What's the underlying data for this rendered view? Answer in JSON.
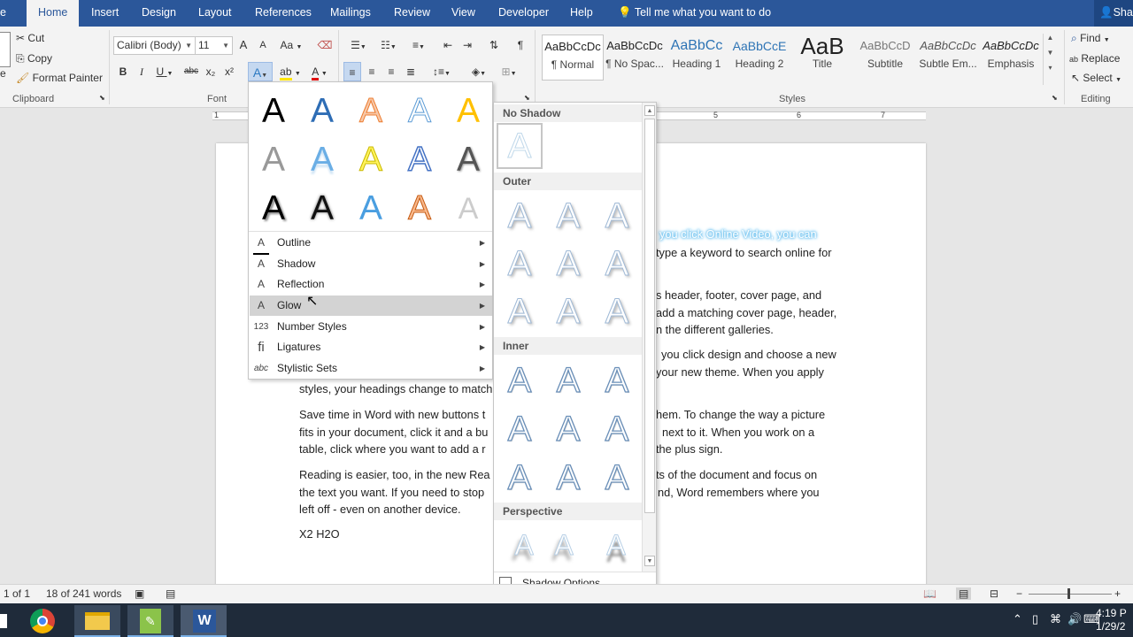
{
  "tabs": [
    {
      "label": "e",
      "active": false
    },
    {
      "label": "Home",
      "active": true
    },
    {
      "label": "Insert",
      "active": false
    },
    {
      "label": "Design",
      "active": false
    },
    {
      "label": "Layout",
      "active": false
    },
    {
      "label": "References",
      "active": false
    },
    {
      "label": "Mailings",
      "active": false
    },
    {
      "label": "Review",
      "active": false
    },
    {
      "label": "View",
      "active": false
    },
    {
      "label": "Developer",
      "active": false
    },
    {
      "label": "Help",
      "active": false
    }
  ],
  "tell_me": "Tell me what you want to do",
  "user_share": "Sha",
  "clipboard": {
    "cut": "Cut",
    "copy": "Copy",
    "format_painter": "Format Painter",
    "label": "Clipboard"
  },
  "font": {
    "name": "Calibri (Body)",
    "size": "11",
    "label": "Font",
    "bold": "B",
    "italic": "I",
    "underline": "U",
    "strike": "abc",
    "subscript": "x₂",
    "superscript": "x²",
    "grow": "A",
    "shrink": "A",
    "case": "Aa"
  },
  "styles": {
    "label": "Styles",
    "items": [
      {
        "preview": "AaBbCcDc",
        "name": "¶ Normal",
        "selected": true
      },
      {
        "preview": "AaBbCcDc",
        "name": "¶ No Spac...",
        "selected": false
      },
      {
        "preview": "AaBbCc",
        "name": "Heading 1",
        "selected": false
      },
      {
        "preview": "AaBbCcE",
        "name": "Heading 2",
        "selected": false
      },
      {
        "preview": "AaB",
        "name": "Title",
        "selected": false
      },
      {
        "preview": "AaBbCcD",
        "name": "Subtitle",
        "selected": false
      },
      {
        "preview": "AaBbCcDc",
        "name": "Subtle Em...",
        "selected": false
      },
      {
        "preview": "AaBbCcDc",
        "name": "Emphasis",
        "selected": false
      }
    ]
  },
  "editing": {
    "find": "Find",
    "replace": "Replace",
    "select": "Select",
    "label": "Editing"
  },
  "ruler_marks": [
    "1",
    "5",
    "6",
    "7"
  ],
  "document": {
    "glow_line": "you click Online Video, you can",
    "lines": [
      "type a keyword to search online for",
      "s header, footer, cover page, and",
      "add a matching cover page, header,",
      "n the different galleries.",
      "you click design and choose a new",
      "your new theme. When you apply",
      "styles, your headings change to match"
    ],
    "para3": [
      "Save time in Word with new buttons t",
      "hem. To change the way a picture",
      "fits in your document, click it and a bu",
      "next to it. When you work on a",
      "table, click where you want to add a r",
      "the plus sign."
    ],
    "para4": [
      "Reading is easier, too, in the new Rea",
      "ts of the document and focus on",
      "the text you want. If you need to stop",
      "nd, Word remembers where you",
      "left off - even on another device."
    ],
    "last_line": "X2   H2O"
  },
  "text_effects_menu": {
    "icon_glyph": "A",
    "items": [
      {
        "icon": "A",
        "label": "Outline",
        "hover": false
      },
      {
        "icon": "A",
        "label": "Shadow",
        "hover": false
      },
      {
        "icon": "A",
        "label": "Reflection",
        "hover": false
      },
      {
        "icon": "A",
        "label": "Glow",
        "hover": true
      },
      {
        "icon": "123",
        "label": "Number Styles",
        "hover": false
      },
      {
        "icon": "fi",
        "label": "Ligatures",
        "hover": false
      },
      {
        "icon": "abc",
        "label": "Stylistic Sets",
        "hover": false
      }
    ]
  },
  "shadow_gallery": {
    "sections": [
      "No Shadow",
      "Outer",
      "Inner",
      "Perspective"
    ],
    "glyph": "A",
    "options_label": "Shadow Options..."
  },
  "statusbar": {
    "page": "1 of 1",
    "words": "18 of 241 words"
  },
  "taskbar": {
    "time": "4:19 P",
    "date": "1/29/2"
  },
  "colors": {
    "word_blue": "#2b579a",
    "glow_blue": "#6ac2f0",
    "hover_gray": "#d3d3d3"
  }
}
